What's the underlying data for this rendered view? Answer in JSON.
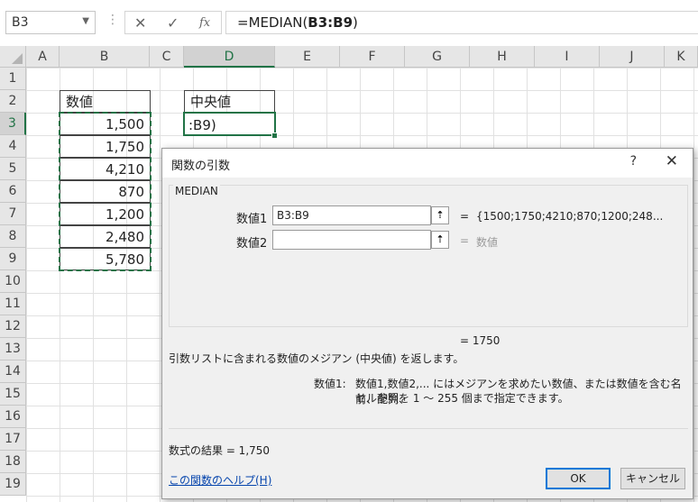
{
  "formula_bar": {
    "name_box": "B3",
    "cancel_icon": "✕",
    "enter_icon": "✓",
    "fx_label": "fx",
    "formula_prefix": "=MEDIAN(",
    "formula_ref": "B3:B9",
    "formula_suffix": ")"
  },
  "columns": [
    "A",
    "B",
    "C",
    "D",
    "E",
    "F",
    "G",
    "H",
    "I",
    "J",
    "K"
  ],
  "rows": [
    "1",
    "2",
    "3",
    "4",
    "5",
    "6",
    "7",
    "8",
    "9",
    "10",
    "11",
    "12",
    "13",
    "14",
    "15",
    "16",
    "17",
    "18",
    "19"
  ],
  "sheet": {
    "b_header": "数値",
    "values": [
      "1,500",
      "1,750",
      "4,210",
      "870",
      "1,200",
      "2,480",
      "5,780"
    ],
    "d_header": "中央値",
    "d3_edit": ":B9)"
  },
  "dialog": {
    "title": "関数の引数",
    "help_q": "?",
    "close": "✕",
    "function_name": "MEDIAN",
    "arg1_label": "数値1",
    "arg1_value": "B3:B9",
    "arg1_result": "{1500;1750;4210;870;1200;248...",
    "arg2_label": "数値2",
    "arg2_value": "",
    "arg2_result": "数値",
    "equals": "=",
    "total_equals": "=  1750",
    "description": "引数リストに含まれる数値のメジアン (中央値) を返します。",
    "arg_help_label": "数値1:",
    "arg_help_line1": "数値1,数値2,... にはメジアンを求めたい数値、または数値を含む名前、配列、",
    "arg_help_line2": "セル参照を 1 ～ 255 個まで指定できます。",
    "result_label": "数式の結果 =  1,750",
    "help_link": "この関数のヘルプ(H)",
    "ok": "OK",
    "cancel": "キャンセル"
  }
}
